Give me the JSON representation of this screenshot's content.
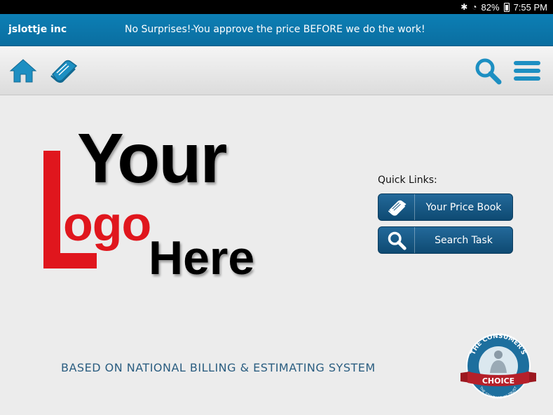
{
  "status_bar": {
    "battery": "82%",
    "time": "7:55 PM",
    "icons": [
      "bluetooth-icon",
      "wifi-icon",
      "battery-icon"
    ]
  },
  "header": {
    "company": "jslottje inc",
    "slogan": "No Surprises!-You approve the price BEFORE we do the work!"
  },
  "toolbar": {
    "icons": [
      "home-icon",
      "price-book-icon",
      "search-icon",
      "menu-icon"
    ]
  },
  "logo": {
    "line1": "Your",
    "line2_initial": "L",
    "line2_rest": "ogo",
    "line3": "Here"
  },
  "quick_links": {
    "title": "Quick Links:",
    "items": [
      {
        "label": "Your Price Book",
        "icon": "book-icon"
      },
      {
        "label": "Search Task",
        "icon": "search-icon"
      }
    ]
  },
  "footer": {
    "based_on": "BASED ON NATIONAL BILLING & ESTIMATING SYSTEM"
  },
  "badge": {
    "top_text": "THE CONSUMER'S",
    "ribbon_text": "CHOICE",
    "bottom_text": "THE STANDARD OF TRUST"
  },
  "colors": {
    "header_blue": "#0d7fb5",
    "button_blue": "#1a5a88",
    "logo_red": "#e0161d",
    "icon_blue": "#1d8fc2"
  }
}
